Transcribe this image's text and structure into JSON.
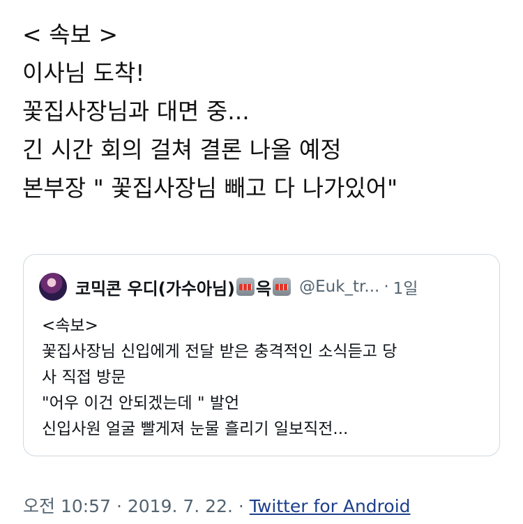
{
  "tweet": {
    "lines": [
      "< 속보 >",
      "이사님 도착!",
      "꽃집사장님과 대면 중...",
      "긴 시간 회의 걸쳐 결론 나올 예정",
      "본부장 \" 꽃집사장님 빼고 다 나가있어\""
    ]
  },
  "quote": {
    "display_name": "코믹콘 우디(가수아님)",
    "name_suffix": "윽",
    "handle": "@Euk_tr...",
    "separator": "·",
    "age": "1일",
    "lines": [
      "<속보>",
      "꽃집사장님 신입에게 전달 받은 충격적인 소식듣고 당",
      "사 직접 방문",
      "\"어우 이건 안되겠는데 \" 발언",
      "신입사원 얼굴 빨게져 눈물 흘리기 일보직전..."
    ]
  },
  "meta": {
    "time": "오전 10:57",
    "sep1": "·",
    "date": "2019. 7. 22.",
    "sep2": "·",
    "source": "Twitter for Android"
  },
  "icons": {
    "avatar": "profile-photo",
    "emoji": "slot-machine-icon"
  },
  "colors": {
    "text": "#0f1419",
    "secondary": "#536471",
    "link": "#1d3f8a",
    "border": "#cfd9de"
  }
}
